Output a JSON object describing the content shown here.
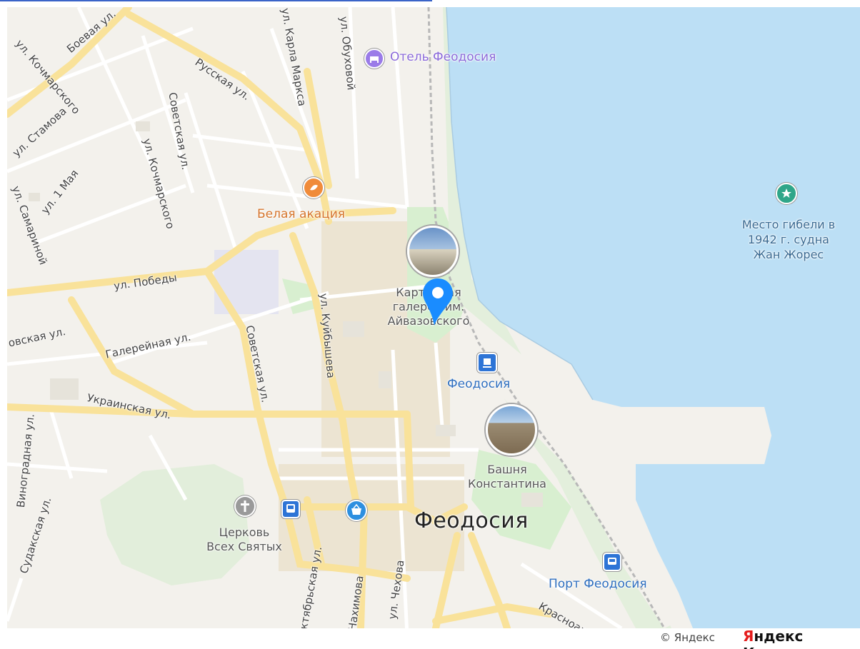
{
  "map": {
    "city_label": "Феодосия",
    "colors": {
      "sea": "#bcdff5",
      "land": "#f3f1ec",
      "road_major": "#f9e29a",
      "road_minor": "#ffffff",
      "pin": "#1a8cff"
    },
    "streets": {
      "boevaya": "Боевая ул.",
      "kochmarskogo_top": "ул. Кочмарского",
      "stamova": "ул. Стамова",
      "russkaya": "Русская ул.",
      "karla_marksa": "ул. Карла Маркса",
      "obukhovoy": "ул. Обуховой",
      "sovetskaya_top": "Советская ул.",
      "kochmarskogo_mid": "ул. Кочмарского",
      "pervogo_maya": "ул. 1 Мая",
      "samarinoy": "ул. Самариной",
      "pobedy": "ул. Победы",
      "kuybysheva": "ул. Куйбышева",
      "galereynaya": "Галерейная ул.",
      "sovetskaya": "Советская ул.",
      "ukrainskaya": "Украинская ул.",
      "left_partial": "овская ул.",
      "vinogradnaya": "Виноградная ул.",
      "sudakskaya": "Судакская ул.",
      "oktyabrskaya": "ктябрьская ул.",
      "nakhimova": "Нахимова",
      "chekhova": "ул. Чехова",
      "krasnoar": "Красноар"
    },
    "pois": {
      "hotel": "Отель Феодосия",
      "belaya_akatsiya": "Белая акация",
      "gallery_l1": "Картинная",
      "gallery_l2": "галерея им.",
      "gallery_l3": "Айвазовского",
      "station": "Феодосия",
      "bashnya_l1": "Башня",
      "bashnya_l2": "Константина",
      "church_l1": "Церковь",
      "church_l2": "Всех Святых",
      "port": "Порт Феодосия",
      "wreck_l1": "Место гибели в",
      "wreck_l2": "1942 г. судна",
      "wreck_l3": "Жан Жорес"
    },
    "icons": [
      "hotel-icon",
      "restaurant-icon",
      "railway-station-icon",
      "bus-stop-icon",
      "shopping-icon",
      "church-icon",
      "port-icon",
      "landmark-star-icon",
      "location-pin-icon"
    ]
  },
  "footer": {
    "copyright": "© Яндекс",
    "brand_y": "Я",
    "brand_rest": "ндекс Карты"
  }
}
